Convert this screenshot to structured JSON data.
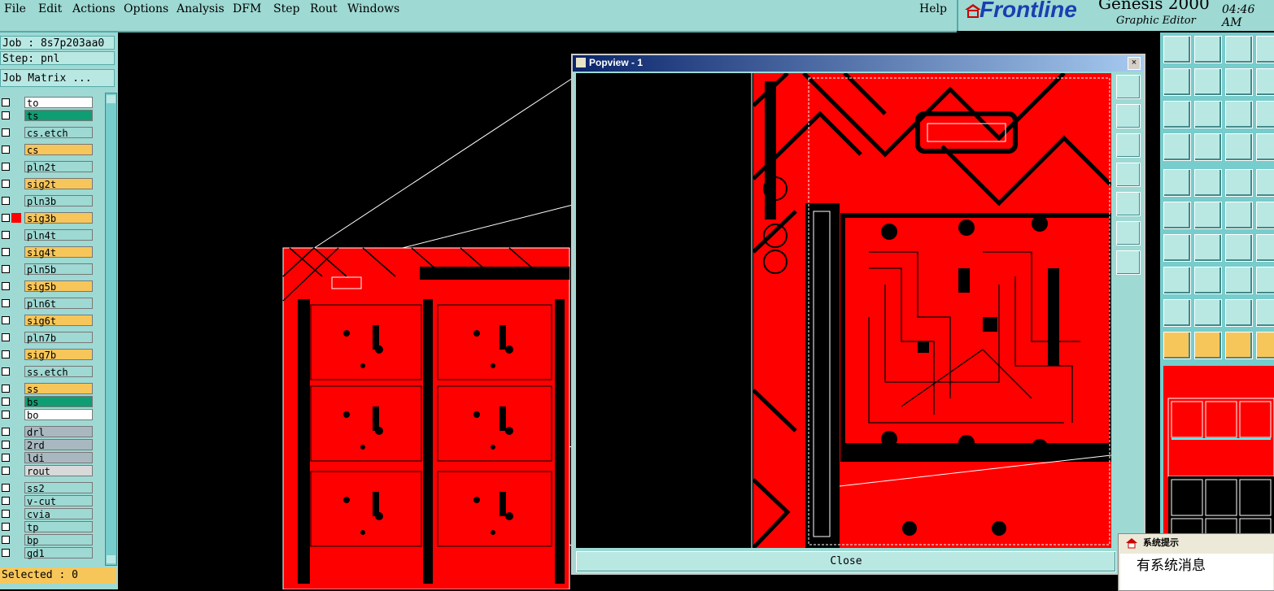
{
  "menubar": {
    "items": [
      "File",
      "Edit",
      "Actions",
      "Options",
      "Analysis",
      "DFM",
      "Step",
      "Rout",
      "Windows"
    ],
    "help": "Help"
  },
  "brand": {
    "name": "Frontline",
    "product": "Genesis 2000",
    "subtitle": "Graphic Editor",
    "time": "04:46 AM"
  },
  "job": {
    "job_label": "Job : 8s7p203aa0",
    "step_label": "Step: pnl",
    "matrix_button": "Job Matrix ..."
  },
  "layers": [
    {
      "name": "to",
      "color": "#ffffff"
    },
    {
      "name": "ts",
      "color": "#0f9d74"
    },
    {
      "name": "cs.etch",
      "color": "#9ed9d3"
    },
    {
      "name": "cs",
      "color": "#f7c65a"
    },
    {
      "name": "pln2t",
      "color": "#9ed9d3"
    },
    {
      "name": "sig2t",
      "color": "#f7c65a"
    },
    {
      "name": "pln3b",
      "color": "#9ed9d3"
    },
    {
      "name": "sig3b",
      "color": "#f7c65a",
      "active": true
    },
    {
      "name": "pln4t",
      "color": "#9ed9d3"
    },
    {
      "name": "sig4t",
      "color": "#f7c65a"
    },
    {
      "name": "pln5b",
      "color": "#9ed9d3"
    },
    {
      "name": "sig5b",
      "color": "#f7c65a"
    },
    {
      "name": "pln6t",
      "color": "#9ed9d3"
    },
    {
      "name": "sig6t",
      "color": "#f7c65a"
    },
    {
      "name": "pln7b",
      "color": "#9ed9d3"
    },
    {
      "name": "sig7b",
      "color": "#f7c65a"
    },
    {
      "name": "ss.etch",
      "color": "#9ed9d3"
    },
    {
      "name": "ss",
      "color": "#f7c65a"
    },
    {
      "name": "bs",
      "color": "#0f9d74"
    },
    {
      "name": "bo",
      "color": "#ffffff"
    },
    {
      "name": "drl",
      "color": "#a9b8c0"
    },
    {
      "name": "2rd",
      "color": "#a9b8c0"
    },
    {
      "name": "ldi",
      "color": "#a9b8c0"
    },
    {
      "name": "rout",
      "color": "#d9d9d9"
    },
    {
      "name": "ss2",
      "color": "#9ed9d3"
    },
    {
      "name": "v-cut",
      "color": "#9ed9d3"
    },
    {
      "name": "cvia",
      "color": "#9ed9d3"
    },
    {
      "name": "tp",
      "color": "#9ed9d3"
    },
    {
      "name": "bp",
      "color": "#9ed9d3"
    },
    {
      "name": "gd1",
      "color": "#9ed9d3"
    }
  ],
  "status": {
    "selected": "Selected : 0"
  },
  "popview": {
    "title": "Popview - 1",
    "close_label": "Close"
  },
  "dialog": {
    "title": "系统提示",
    "message": "有系统消息"
  },
  "colors": {
    "board_red": "#ff0000",
    "panel": "#9ed9d3",
    "accent": "#f7c65a"
  }
}
